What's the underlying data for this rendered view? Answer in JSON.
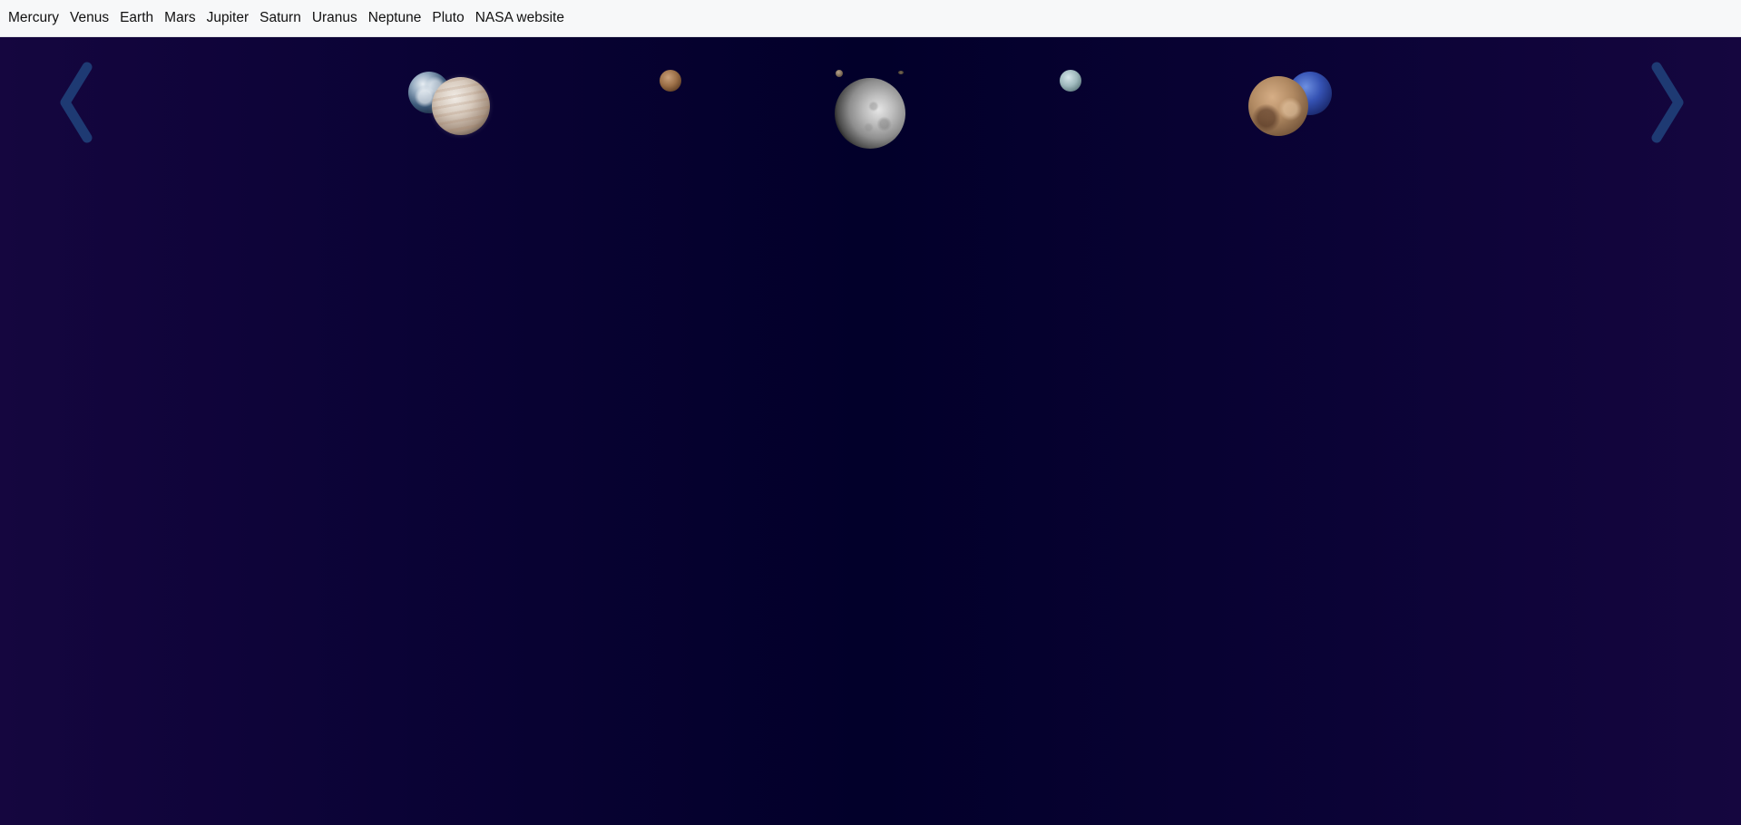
{
  "nav": {
    "links": [
      {
        "label": "Mercury"
      },
      {
        "label": "Venus"
      },
      {
        "label": "Earth"
      },
      {
        "label": "Mars"
      },
      {
        "label": "Jupiter"
      },
      {
        "label": "Saturn"
      },
      {
        "label": "Uranus"
      },
      {
        "label": "Neptune"
      },
      {
        "label": "Pluto"
      },
      {
        "label": "NASA website"
      }
    ]
  },
  "carousel": {
    "prev_icon": "chevron-left-icon",
    "next_icon": "chevron-right-icon",
    "arrow_color": "#1e3a73"
  },
  "colors": {
    "nav_background": "#f7f8f9",
    "space_background": "#06012e"
  }
}
